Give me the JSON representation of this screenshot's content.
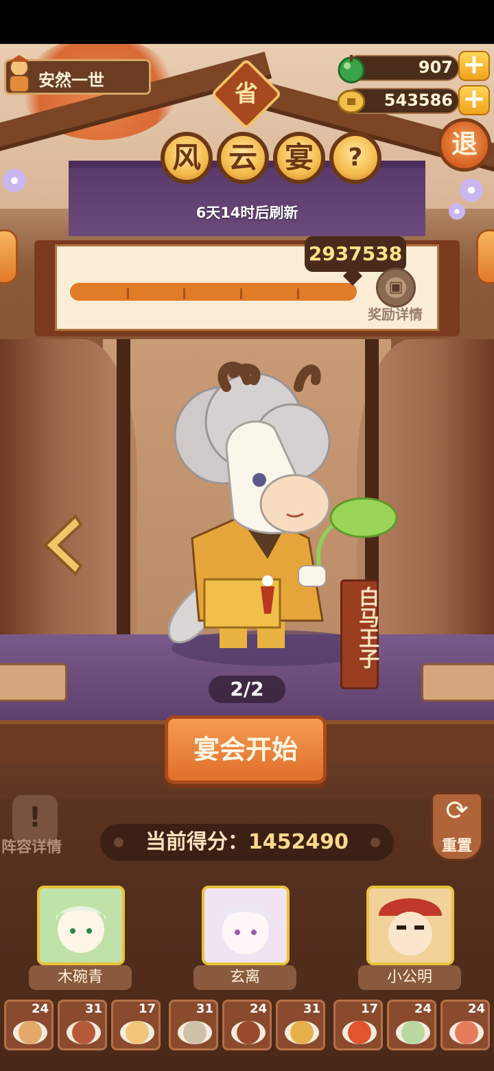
{
  "player": {
    "name": "安然一世"
  },
  "resources": {
    "jade": {
      "value": "907",
      "icon": "green-jade-icon",
      "add": "+"
    },
    "coins": {
      "value": "543586",
      "icon": "copper-coin-icon",
      "add": "+"
    }
  },
  "province_badge": "省",
  "exit_label": "退",
  "event_title": [
    "风",
    "云",
    "宴"
  ],
  "help_label": "?",
  "refresh_text": "6天14时后刷新",
  "progress": {
    "score": "2937538",
    "reward_label": "奖励详情",
    "fill_fraction": 1.0
  },
  "character": {
    "name": "白马王子",
    "page": "2/2"
  },
  "start_button": "宴会开始",
  "lineup_label": "阵容详情",
  "reset_label": "重置",
  "current_score": {
    "label": "当前得分：",
    "value": "1452490"
  },
  "heroes": [
    {
      "name": "木碗青",
      "bg": "#bfe2a8"
    },
    {
      "name": "玄离",
      "bg": "#f0e4f2"
    },
    {
      "name": "小公明",
      "bg": "#f2d29a"
    }
  ],
  "dishes": [
    {
      "count": "24",
      "color": "#e3a86a"
    },
    {
      "count": "31",
      "color": "#b5593a"
    },
    {
      "count": "17",
      "color": "#f1c67a"
    },
    {
      "count": "31",
      "color": "#cfc1a8"
    },
    {
      "count": "24",
      "color": "#9a4a2e"
    },
    {
      "count": "31",
      "color": "#e7b04a"
    },
    {
      "count": "17",
      "color": "#e0542f"
    },
    {
      "count": "24",
      "color": "#b8d8a0"
    },
    {
      "count": "24",
      "color": "#e57b5a"
    }
  ]
}
